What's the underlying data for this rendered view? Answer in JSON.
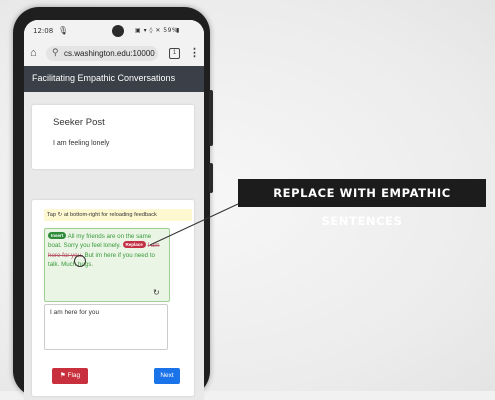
{
  "status_bar": {
    "time": "12:08",
    "mic_glyph": "🎙",
    "icons": "▣ ▾ ◊ ✕ 59%",
    "battery": "▮"
  },
  "browser": {
    "home_glyph": "⌂",
    "lock_glyph": "⚲",
    "url": "cs.washington.edu:10000",
    "tabs_count": "1",
    "menu_glyph": "⋮"
  },
  "app": {
    "title": "Facilitating Empathic Conversations"
  },
  "seeker": {
    "heading": "Seeker Post",
    "text": "I am feeling lonely"
  },
  "response": {
    "hint": "Tap ↻ at bottom-right for reloading feedback",
    "insert_badge": "Insert",
    "insert_text": "All my friends are on the same boat. Sorry you feel lonely.",
    "replace_badge": "Replace",
    "struck_text": "I am here for you.",
    "replacement_text": "But im here if you need to talk. Much hugs.",
    "reload_glyph": "↻",
    "draft": "I am here for you",
    "flag_label": "Flag",
    "flag_glyph": "⚑",
    "next_label": "Next"
  },
  "callout": {
    "text": "REPLACE WITH EMPATHIC SENTENCES"
  },
  "colors": {
    "appbar": "#3b4048",
    "insert": "#2e8b3a",
    "replace": "#c33044",
    "flag": "#c9303e",
    "next": "#1a73e8",
    "hint_bg": "#fdf8cf",
    "feedback_bg": "#eaf5e6"
  }
}
